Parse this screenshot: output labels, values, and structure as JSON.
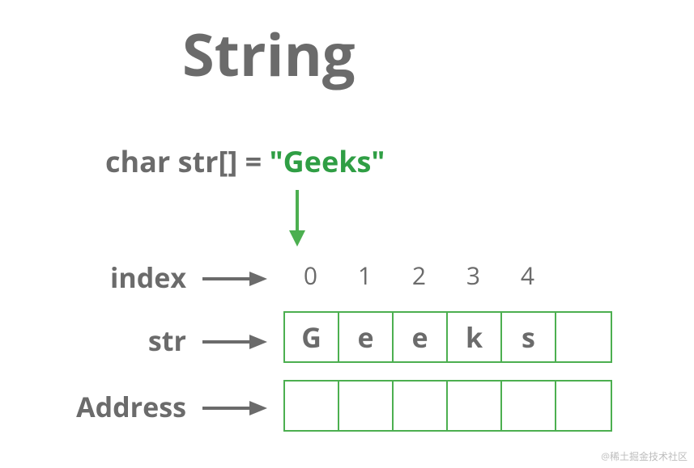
{
  "title": "String",
  "declaration": {
    "prefix": "char str[] = ",
    "literal": "\"Geeks\""
  },
  "labels": {
    "index": "index",
    "str": "str",
    "address": "Address"
  },
  "indices": [
    "0",
    "1",
    "2",
    "3",
    "4",
    ""
  ],
  "chars": [
    "G",
    "e",
    "e",
    "k",
    "s",
    ""
  ],
  "addresses": [
    "",
    "",
    "",
    "",
    "",
    ""
  ],
  "colors": {
    "text": "#6b6b6b",
    "accent": "#4caf50"
  },
  "watermark": "@稀土掘金技术社区"
}
